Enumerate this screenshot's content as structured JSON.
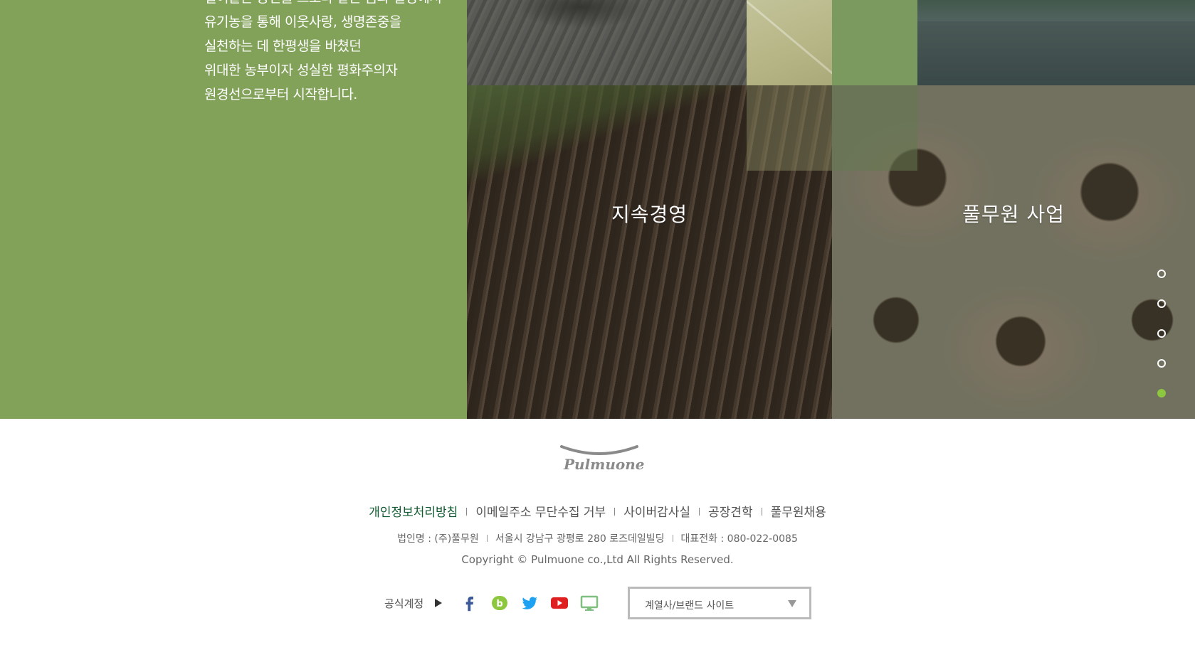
{
  "hero": {
    "intro_lines": [
      "얼어붙은 동면을 그보다 얕은 꿈과 열정에서",
      "유기농을 통해 이웃사랑, 생명존중을",
      "실천하는 데 한평생을 바쳤던",
      "위대한 농부이자 성실한 평화주의자",
      "원경선으로부터 시작합니다."
    ],
    "tiles": {
      "sustainability_label": "지속경영",
      "business_label": "풀무원 사업"
    },
    "pager": {
      "count": 5,
      "active_index": 4
    }
  },
  "footer": {
    "logo_text": "Pulmuone",
    "links": [
      "개인정보처리방침",
      "이메일주소 무단수집 거부",
      "사이버감사실",
      "공장견학",
      "풀무원채용"
    ],
    "info": {
      "company": "법인명 : (주)풀무원",
      "address": "서울시 강남구 광평로 280 로즈데일빌딩",
      "phone": "대표전화 : 080-022-0085"
    },
    "copyright": "Copyright © Pulmuone co.,Ltd All Rights Reserved.",
    "social": {
      "label": "공식계정",
      "icons": [
        "facebook-icon",
        "blog-icon",
        "twitter-icon",
        "youtube-icon",
        "monitor-icon"
      ]
    },
    "family_select": {
      "value": "계열사/브랜드 사이트"
    }
  },
  "colors": {
    "green_panel": "#82a25a",
    "active_dot": "#8dc63f",
    "primary_link": "#0f5a2e",
    "facebook": "#3b5998",
    "blog": "#8dc63f",
    "twitter": "#1da1f2",
    "youtube": "#e02020",
    "monitor": "#7fbf7f"
  }
}
